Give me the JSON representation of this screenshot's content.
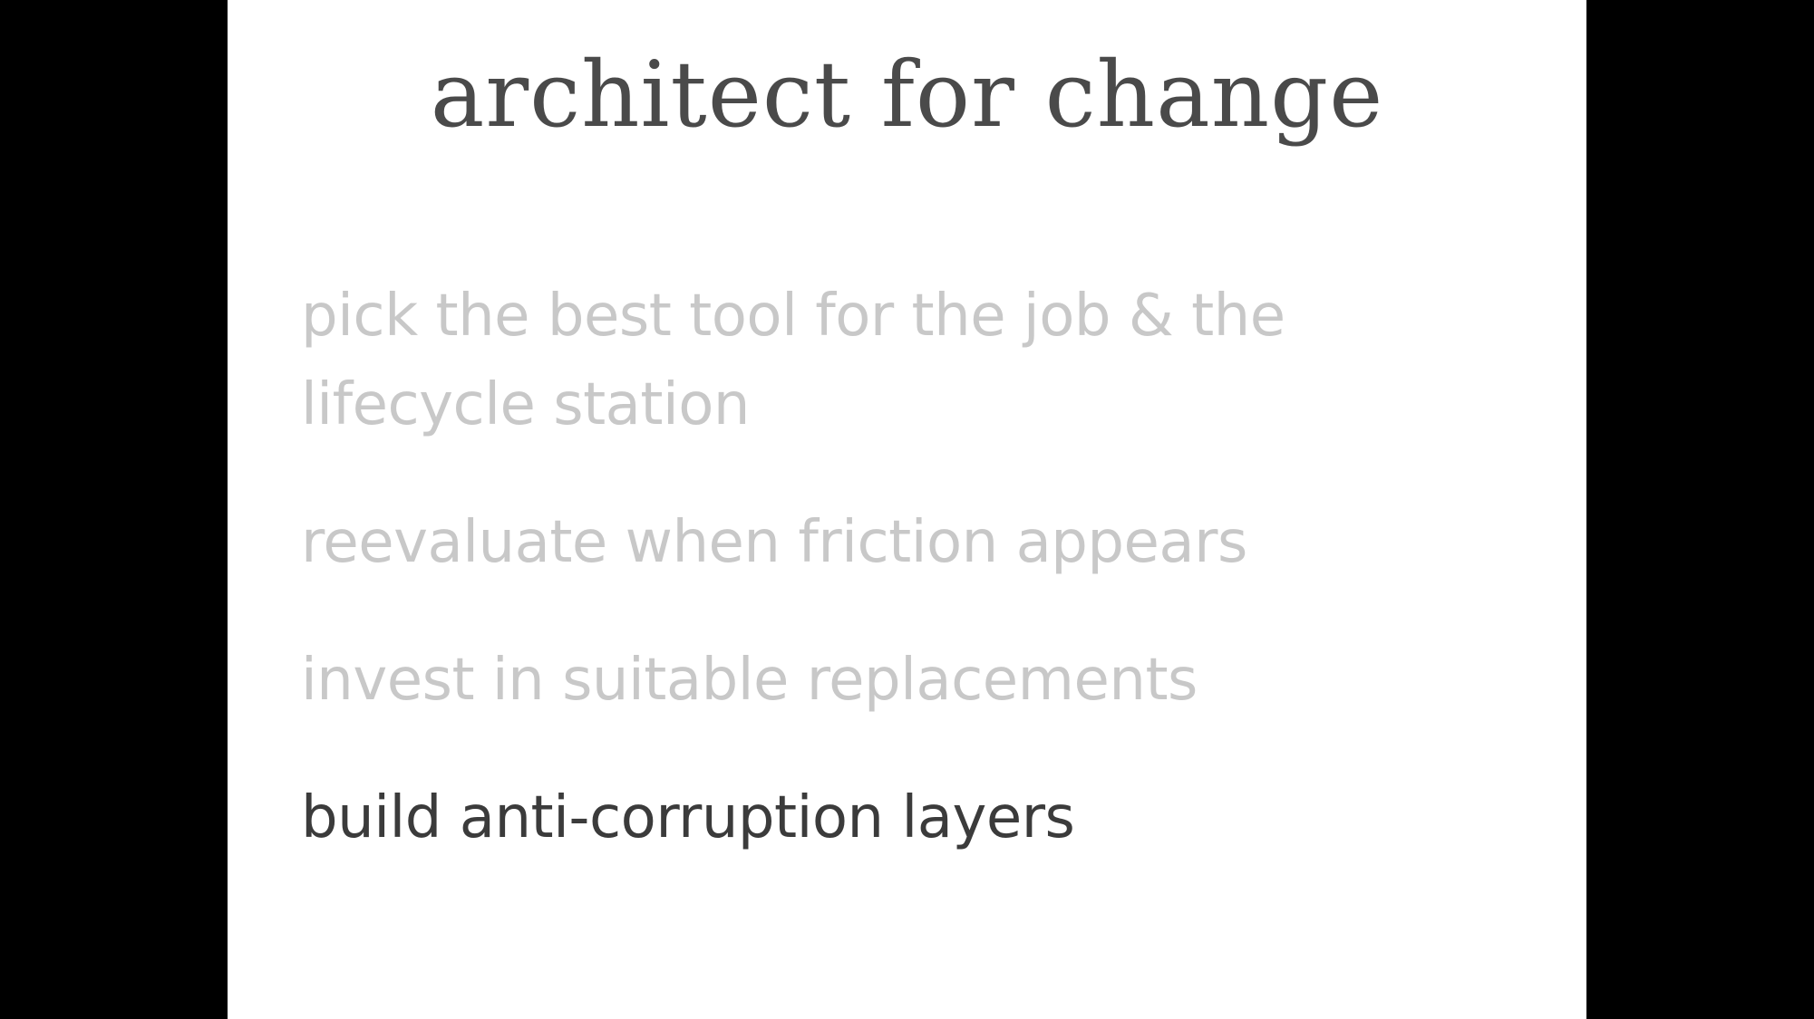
{
  "slide": {
    "title": "architect for change",
    "bullets": [
      {
        "text": "pick the best tool for the job & the lifecycle station",
        "state": "dimmed"
      },
      {
        "text": "reevaluate when friction appears",
        "state": "dimmed"
      },
      {
        "text": "invest in suitable replacements",
        "state": "dimmed"
      },
      {
        "text": "build anti-corruption layers",
        "state": "active"
      }
    ]
  },
  "colors": {
    "background": "#000000",
    "slide": "#ffffff",
    "title": "#4a4a4a",
    "dimmed_text": "#c8c8c8",
    "active_text": "#3b3b3b"
  }
}
